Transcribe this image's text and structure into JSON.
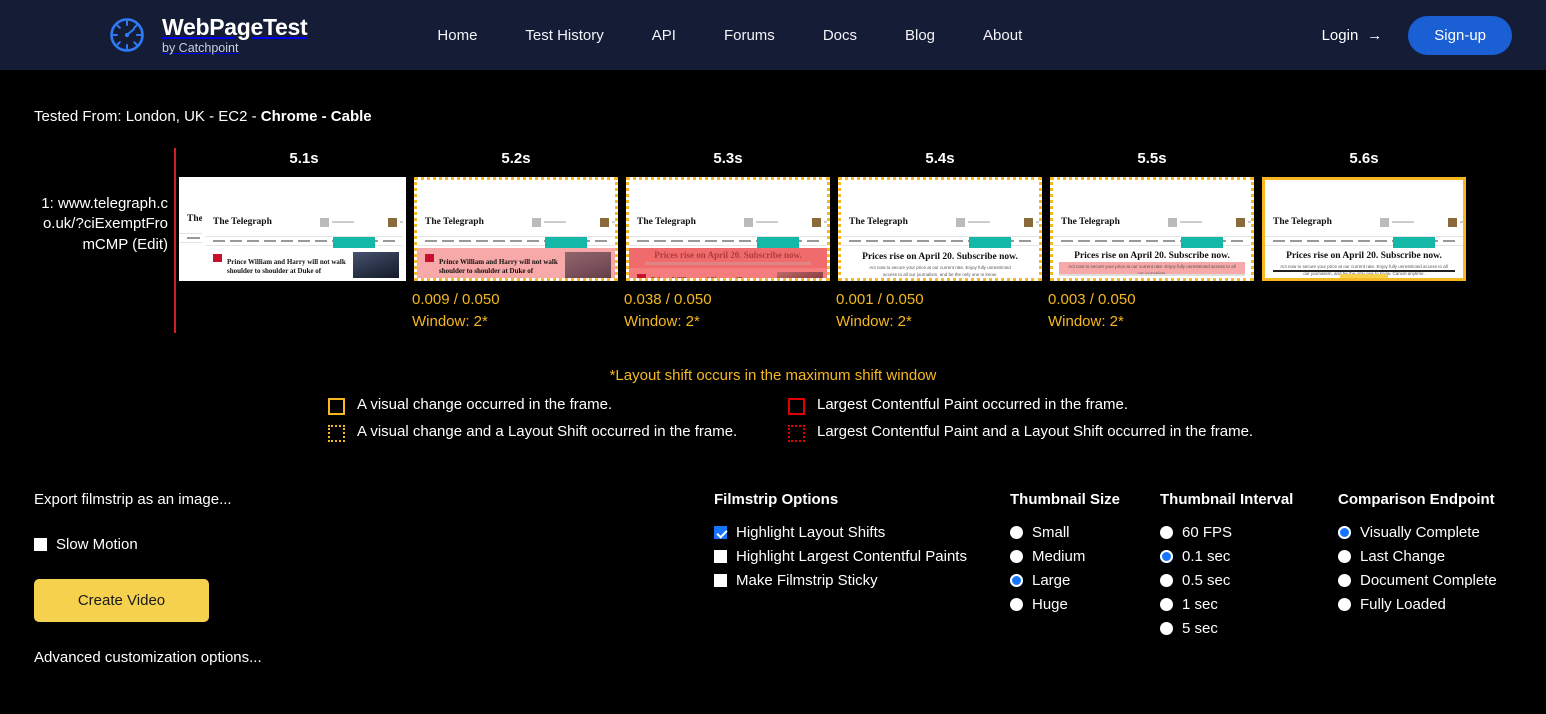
{
  "header": {
    "brand_title": "WebPageTest",
    "brand_subtitle": "by Catchpoint",
    "logo_icon": "speedometer-icon",
    "nav": [
      {
        "label": "Home"
      },
      {
        "label": "Test History"
      },
      {
        "label": "API"
      },
      {
        "label": "Forums"
      },
      {
        "label": "Docs"
      },
      {
        "label": "Blog"
      },
      {
        "label": "About"
      }
    ],
    "login_label": "Login",
    "login_arrow": "→",
    "signup_label": "Sign-up",
    "signup_color": "#1A5FD4",
    "background_color": "#141C36"
  },
  "test_info": {
    "prefix": "Tested From: London, UK - EC2 - ",
    "browser_and_connection": "Chrome - Cable"
  },
  "filmstrip": {
    "run_label": "1: www.telegraph.co.uk/?ciExemptFromCMP (Edit)",
    "timeline_marker_color": "#D1201F",
    "frames": [
      {
        "time": "5.1s",
        "border": "none",
        "cls": null,
        "window": null,
        "state": "headline-photo"
      },
      {
        "time": "5.2s",
        "border": "dotted-gold",
        "cls": "0.009 / 0.050",
        "window": "Window: 2*",
        "state": "shift-light"
      },
      {
        "time": "5.3s",
        "border": "dotted-gold",
        "cls": "0.038 / 0.050",
        "window": "Window: 2*",
        "state": "shift-deep"
      },
      {
        "time": "5.4s",
        "border": "dotted-gold",
        "cls": "0.001 / 0.050",
        "window": "Window: 2*",
        "state": "subscribe-clean"
      },
      {
        "time": "5.5s",
        "border": "dotted-gold",
        "cls": "0.003 / 0.050",
        "window": "Window: 2*",
        "state": "subscribe-shift"
      },
      {
        "time": "5.6s",
        "border": "solid-gold",
        "cls": null,
        "window": null,
        "state": "subscribe-final"
      }
    ],
    "thumbnail_content": {
      "site_logo": "The Telegraph",
      "headline_early": "Prince William and Harry will not walk shoulder to shoulder at Duke of Edinburgh's funeral",
      "headline_late": "Prices rise on April 20. Subscribe now."
    }
  },
  "legend": {
    "note": "*Layout shift occurs in the maximum shift window",
    "note_color": "#F5B820",
    "items": [
      {
        "swatch": "solid-gold",
        "text": "A visual change occurred in the frame."
      },
      {
        "swatch": "solid-red",
        "text": "Largest Contentful Paint occurred in the frame."
      },
      {
        "swatch": "dotted-gold",
        "text": "A visual change and a Layout Shift occurred in the frame."
      },
      {
        "swatch": "dotted-red",
        "text": "Largest Contentful Paint and a Layout Shift occurred in the frame."
      }
    ]
  },
  "export": {
    "title": "Export filmstrip as an image...",
    "slow_motion_label": "Slow Motion",
    "slow_motion_checked": false,
    "create_video_label": "Create Video",
    "create_video_color": "#F5D14E",
    "advanced_label": "Advanced customization options..."
  },
  "filmstrip_options": {
    "title": "Filmstrip Options",
    "items": [
      {
        "label": "Highlight Layout Shifts",
        "checked": true
      },
      {
        "label": "Highlight Largest Contentful Paints",
        "checked": false
      },
      {
        "label": "Make Filmstrip Sticky",
        "checked": false
      }
    ]
  },
  "thumbnail_size": {
    "title": "Thumbnail Size",
    "items": [
      {
        "label": "Small",
        "selected": false
      },
      {
        "label": "Medium",
        "selected": false
      },
      {
        "label": "Large",
        "selected": true
      },
      {
        "label": "Huge",
        "selected": false
      }
    ]
  },
  "thumbnail_interval": {
    "title": "Thumbnail Interval",
    "items": [
      {
        "label": "60 FPS",
        "selected": false
      },
      {
        "label": "0.1 sec",
        "selected": true
      },
      {
        "label": "0.5 sec",
        "selected": false
      },
      {
        "label": "1 sec",
        "selected": false
      },
      {
        "label": "5 sec",
        "selected": false
      }
    ]
  },
  "comparison_endpoint": {
    "title": "Comparison Endpoint",
    "items": [
      {
        "label": "Visually Complete",
        "selected": true
      },
      {
        "label": "Last Change",
        "selected": false
      },
      {
        "label": "Document Complete",
        "selected": false
      },
      {
        "label": "Fully Loaded",
        "selected": false
      }
    ]
  },
  "accent_colors": {
    "gold": "#F5B820",
    "blue": "#1675FF",
    "red": "#D1201F"
  }
}
